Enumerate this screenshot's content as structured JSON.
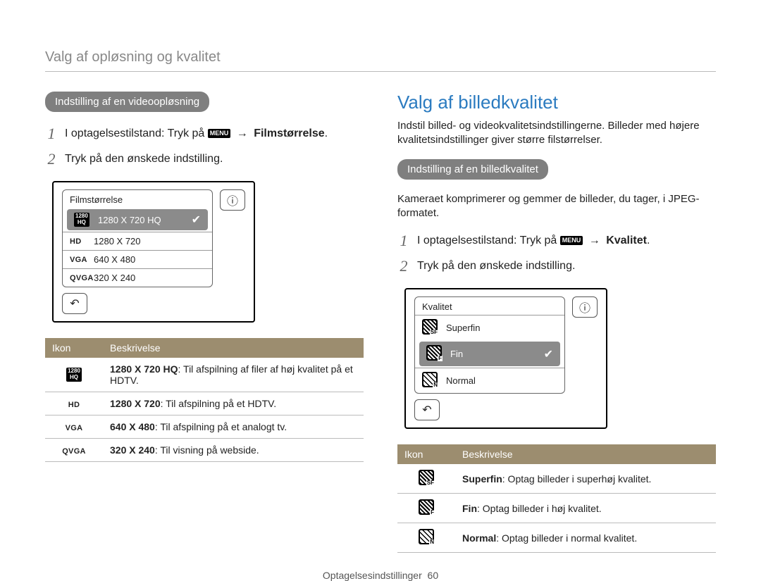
{
  "breadcrumb": "Valg af opløsning og kvalitet",
  "left": {
    "pill": "Indstilling af en videoopløsning",
    "steps": [
      {
        "num": "1",
        "pre": "I optagelsestilstand: Tryk på ",
        "menu": "MENU",
        "post_arrow": "→",
        "bold": "Filmstørrelse",
        "tail": "."
      },
      {
        "num": "2",
        "text": "Tryk på den ønskede indstilling."
      }
    ],
    "screen": {
      "title": "Filmstørrelse",
      "info": "ⓘ",
      "back": "↶",
      "rows": [
        {
          "icon_type": "hd1280",
          "label": "1280 X 720 HQ",
          "selected": true
        },
        {
          "icon_type": "hd",
          "label": "1280 X 720"
        },
        {
          "icon_type": "vga",
          "label": "640 X 480"
        },
        {
          "icon_type": "qvga",
          "label": "320 X 240"
        }
      ]
    },
    "table": {
      "headers": [
        "Ikon",
        "Beskrivelse"
      ],
      "rows": [
        {
          "icon_type": "hd1280",
          "bold": "1280 X 720 HQ",
          "desc": ": Til afspilning af filer af høj kvalitet på et HDTV."
        },
        {
          "icon_type": "hd",
          "bold": "1280 X 720",
          "desc": ": Til afspilning på et HDTV."
        },
        {
          "icon_type": "vga",
          "bold": "640 X 480",
          "desc": ": Til afspilning på et analogt tv."
        },
        {
          "icon_type": "qvga",
          "bold": "320 X 240",
          "desc": ": Til visning på webside."
        }
      ]
    }
  },
  "right": {
    "title": "Valg af billedkvalitet",
    "intro": "Indstil billed- og videokvalitetsindstillingerne. Billeder med højere kvalitetsindstillinger giver større filstørrelser.",
    "pill": "Indstilling af en billedkvalitet",
    "para": "Kameraet komprimerer og gemmer de billeder, du tager, i JPEG-formatet.",
    "steps": [
      {
        "num": "1",
        "pre": "I optagelsestilstand: Tryk på ",
        "menu": "MENU",
        "post_arrow": "→",
        "bold": "Kvalitet",
        "tail": "."
      },
      {
        "num": "2",
        "text": "Tryk på den ønskede indstilling."
      }
    ],
    "screen": {
      "title": "Kvalitet",
      "info": "ⓘ",
      "back": "↶",
      "rows": [
        {
          "icon_type": "sf",
          "label": "Superfin"
        },
        {
          "icon_type": "f",
          "label": "Fin",
          "selected": true
        },
        {
          "icon_type": "n",
          "label": "Normal"
        }
      ]
    },
    "table": {
      "headers": [
        "Ikon",
        "Beskrivelse"
      ],
      "rows": [
        {
          "icon_type": "sf",
          "bold": "Superfin",
          "desc": ": Optag billeder i superhøj kvalitet."
        },
        {
          "icon_type": "f",
          "bold": "Fin",
          "desc": ": Optag billeder i høj kvalitet."
        },
        {
          "icon_type": "n",
          "bold": "Normal",
          "desc": ": Optag billeder i normal kvalitet."
        }
      ]
    }
  },
  "footer": {
    "section": "Optagelsesindstillinger",
    "page": "60"
  }
}
